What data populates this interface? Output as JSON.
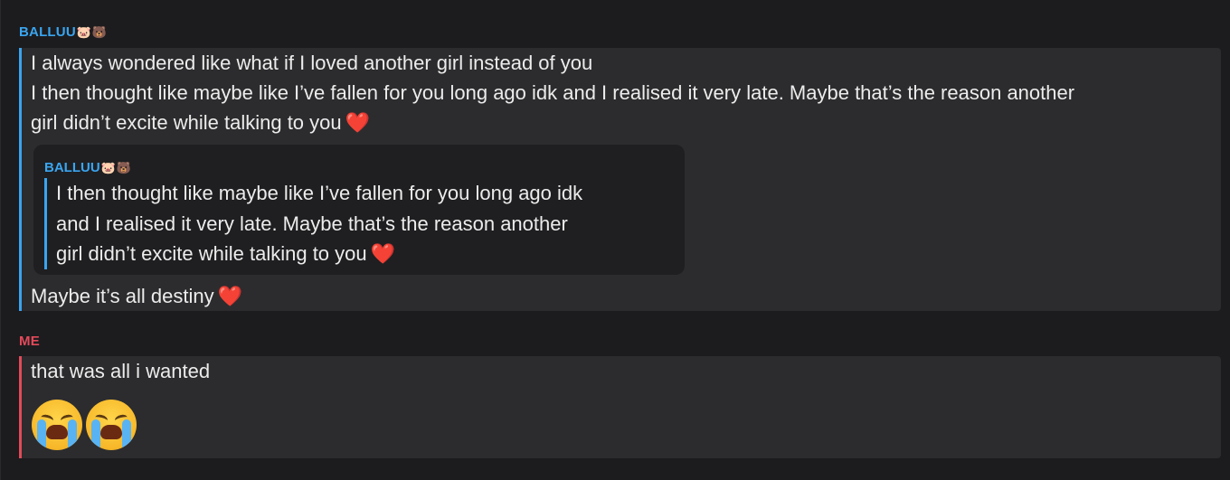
{
  "messages": [
    {
      "sender": {
        "name": "BALLUU",
        "emojis": [
          "🐷",
          "🐻"
        ],
        "color": "#3aa5f0"
      },
      "lines": [
        "I always wondered like what if I loved another girl instead of you",
        "I then thought like maybe like I’ve fallen for you long ago idk and I realised it very late. Maybe that’s the reason another",
        "girl didn’t excite while talking to you"
      ],
      "quote": {
        "sender": {
          "name": "BALLUU",
          "emojis": [
            "🐷",
            "🐻"
          ]
        },
        "lines": [
          "I then thought like maybe like I’ve fallen for you long ago idk",
          "and I realised it very late. Maybe that’s the reason another",
          "girl didn’t excite while talking to you"
        ]
      },
      "after_quote": "Maybe it’s all destiny",
      "heart": "❤️"
    },
    {
      "sender": {
        "name": "ME",
        "color": "#e34a5b"
      },
      "lines": [
        "that was all i wanted"
      ],
      "emojis": [
        "loudly-crying-face-icon",
        "loudly-crying-face-icon"
      ]
    }
  ]
}
